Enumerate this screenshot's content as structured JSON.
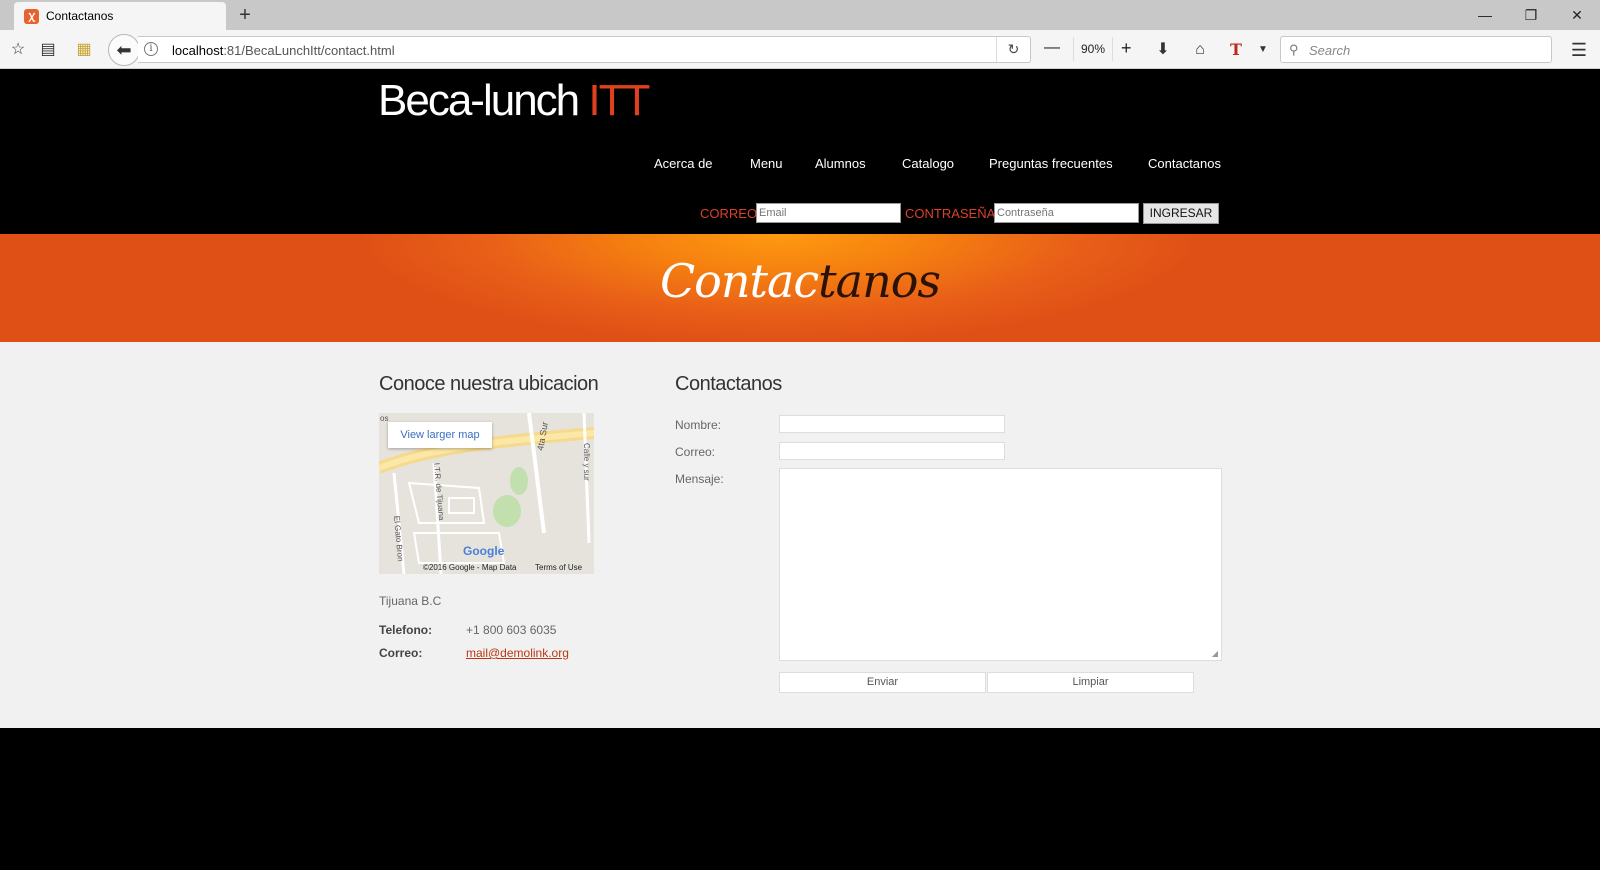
{
  "browser": {
    "tab_title": "Contactanos",
    "url_host": "localhost",
    "url_rest": ":81/BecaLunchItt/contact.html",
    "zoom": "90%",
    "search_placeholder": "Search"
  },
  "site": {
    "logo_main": "Beca-lunch ",
    "logo_accent": "ITT",
    "nav": [
      "Acerca de",
      "Menu",
      "Alumnos",
      "Catalogo",
      "Preguntas frecuentes",
      "Contactanos"
    ],
    "login": {
      "email_label": "CORREO",
      "email_placeholder": "Email",
      "password_label": "CONTRASEÑA",
      "password_placeholder": "Contraseña",
      "submit_label": "INGRESAR"
    },
    "banner": {
      "title_light": "Contac",
      "title_dark": "tanos"
    }
  },
  "location": {
    "heading": "Conoce nuestra ubicacion",
    "map_link": "View larger map",
    "map_copyright": "©2016 Google - Map Data",
    "map_terms": "Terms of Use",
    "map_logo": "Google",
    "map_streets": [
      "4ta Sur",
      "I.T.R. de Tijuana",
      "El Gato Bron",
      "Calle y sur",
      "os"
    ],
    "address": "Tijuana B.C",
    "phone_label": "Telefono:",
    "phone_value": "+1 800 603 6035",
    "email_label": "Correo:",
    "email_value": "mail@demolink.org"
  },
  "contact_form": {
    "heading": "Contactanos",
    "name_label": "Nombre:",
    "email_label": "Correo:",
    "message_label": "Mensaje:",
    "send_label": "Enviar",
    "clear_label": "Limpiar"
  }
}
